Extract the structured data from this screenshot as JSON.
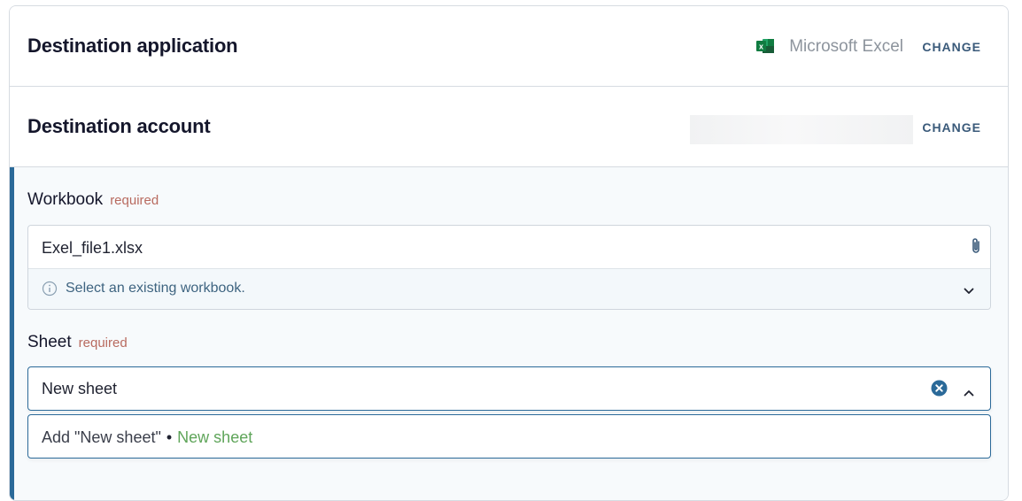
{
  "destination_application": {
    "title": "Destination application",
    "app_name": "Microsoft Excel",
    "app_icon": "excel-icon",
    "change_label": "CHANGE"
  },
  "destination_account": {
    "title": "Destination account",
    "change_label": "CHANGE"
  },
  "workbook": {
    "label": "Workbook",
    "required_label": "required",
    "value": "Exel_file1.xlsx",
    "hint": "Select an existing workbook."
  },
  "sheet": {
    "label": "Sheet",
    "required_label": "required",
    "value": "New sheet",
    "option": {
      "prefix": "Add \"New sheet\"",
      "separator": "•",
      "name": "New sheet"
    }
  },
  "colors": {
    "accent": "#2b6a99",
    "required": "#b86a5f",
    "option_green": "#5fa55a"
  }
}
